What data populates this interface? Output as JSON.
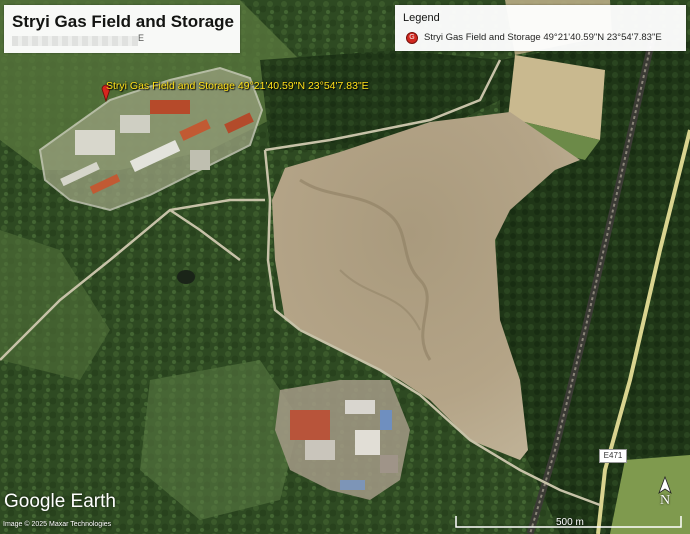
{
  "title": "Stryi Gas Field and Storage",
  "title_subtext": "E",
  "legend": {
    "heading": "Legend",
    "entries": [
      {
        "icon": "placemark-icon",
        "icon_color": "#d8261f",
        "icon_letter": "G",
        "text": "Stryi Gas Field and Storage 49°21'40.59\"N 23°54'7.83\"E"
      }
    ]
  },
  "placemark": {
    "label": "Stryi Gas Field and Storage   49°21'40.59\"N   23°54'7.83\"E",
    "label_color": "#ffe11a",
    "marker_color": "#d8261f"
  },
  "road_label": "E471",
  "branding": {
    "logo": "Google Earth",
    "credit": "Image © 2025 Maxar Technologies"
  },
  "compass": {
    "letter": "N"
  },
  "scale": {
    "label": "500 m"
  }
}
